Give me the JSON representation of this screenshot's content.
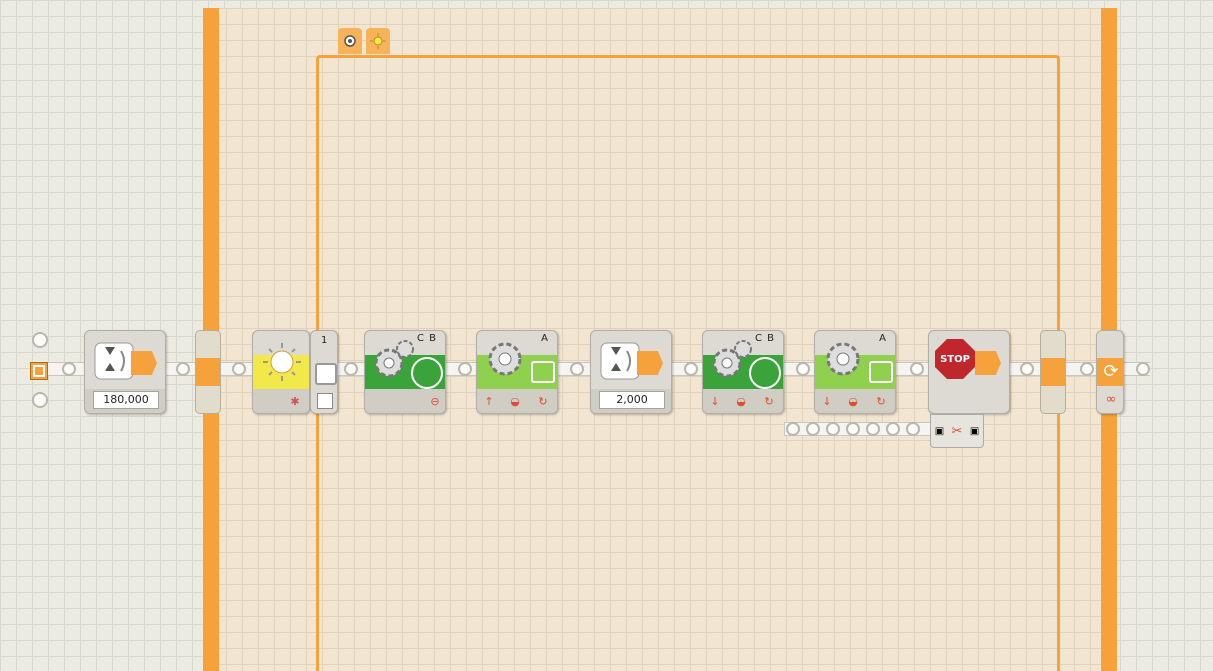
{
  "program": {
    "start_label": "Start",
    "wait_time": "180,000",
    "switch_tabs": [
      "sensor-view-icon",
      "light-sensor-icon"
    ],
    "light_sensor": {
      "port": "1"
    },
    "motor_cb_1": {
      "ports": "C B"
    },
    "motor_a_1": {
      "port": "A"
    },
    "wait_time_2": "2,000",
    "motor_cb_2": {
      "ports": "C B"
    },
    "motor_a_2": {
      "port": "A"
    },
    "stop_label": "STOP",
    "loop_mode": "∞"
  },
  "colors": {
    "loop": "#f5a23c",
    "motor_green": "#3aa33a",
    "motor_lime": "#8fd14f",
    "light_yellow": "#f2e84a",
    "stop_red": "#c0272d"
  }
}
